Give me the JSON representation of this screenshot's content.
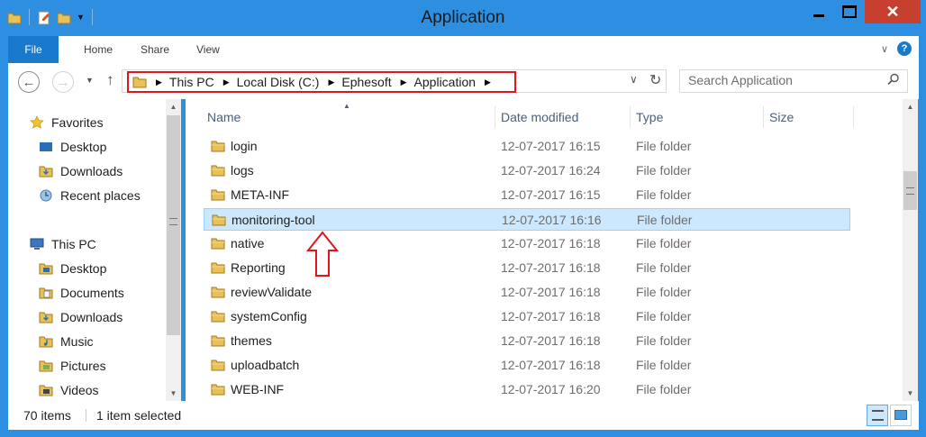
{
  "window": {
    "title": "Application"
  },
  "ribbon": {
    "tabs": [
      "File",
      "Home",
      "Share",
      "View"
    ]
  },
  "address": {
    "crumbs": [
      "This PC",
      "Local Disk (C:)",
      "Ephesoft",
      "Application"
    ],
    "search_placeholder": "Search Application"
  },
  "nav": {
    "favorites": {
      "label": "Favorites",
      "items": [
        "Desktop",
        "Downloads",
        "Recent places"
      ]
    },
    "thispc": {
      "label": "This PC",
      "items": [
        "Desktop",
        "Documents",
        "Downloads",
        "Music",
        "Pictures",
        "Videos"
      ]
    }
  },
  "columns": {
    "name": "Name",
    "date": "Date modified",
    "type": "Type",
    "size": "Size"
  },
  "files": [
    {
      "name": "login",
      "date": "12-07-2017 16:15",
      "type": "File folder"
    },
    {
      "name": "logs",
      "date": "12-07-2017 16:24",
      "type": "File folder"
    },
    {
      "name": "META-INF",
      "date": "12-07-2017 16:15",
      "type": "File folder"
    },
    {
      "name": "monitoring-tool",
      "date": "12-07-2017 16:16",
      "type": "File folder"
    },
    {
      "name": "native",
      "date": "12-07-2017 16:18",
      "type": "File folder"
    },
    {
      "name": "Reporting",
      "date": "12-07-2017 16:18",
      "type": "File folder"
    },
    {
      "name": "reviewValidate",
      "date": "12-07-2017 16:18",
      "type": "File folder"
    },
    {
      "name": "systemConfig",
      "date": "12-07-2017 16:18",
      "type": "File folder"
    },
    {
      "name": "themes",
      "date": "12-07-2017 16:18",
      "type": "File folder"
    },
    {
      "name": "uploadbatch",
      "date": "12-07-2017 16:18",
      "type": "File folder"
    },
    {
      "name": "WEB-INF",
      "date": "12-07-2017 16:20",
      "type": "File folder"
    }
  ],
  "selected_file": "monitoring-tool",
  "status": {
    "count": "70 items",
    "selection": "1 item selected"
  },
  "colors": {
    "accent": "#2e8ee0",
    "highlight": "#e0161a",
    "selection": "#cce8ff",
    "close": "#c7402f"
  }
}
